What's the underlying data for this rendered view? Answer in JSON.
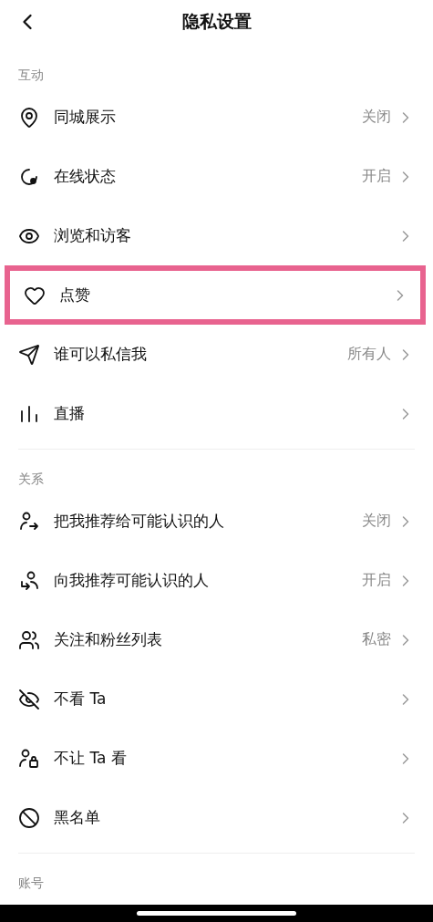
{
  "header": {
    "title": "隐私设置"
  },
  "sections": [
    {
      "label": "互动",
      "items": [
        {
          "label": "同城展示",
          "value": "关闭",
          "highlighted": false
        },
        {
          "label": "在线状态",
          "value": "开启",
          "highlighted": false
        },
        {
          "label": "浏览和访客",
          "highlighted": false
        },
        {
          "label": "点赞",
          "highlighted": true
        },
        {
          "label": "谁可以私信我",
          "value": "所有人",
          "highlighted": false
        },
        {
          "label": "直播",
          "highlighted": false
        }
      ]
    },
    {
      "label": "关系",
      "items": [
        {
          "label": "把我推荐给可能认识的人",
          "value": "关闭",
          "highlighted": false
        },
        {
          "label": "向我推荐可能认识的人",
          "value": "开启",
          "highlighted": false
        },
        {
          "label": "关注和粉丝列表",
          "value": "私密",
          "highlighted": false
        },
        {
          "label": "不看 Ta",
          "highlighted": false
        },
        {
          "label": "不让 Ta 看",
          "highlighted": false
        },
        {
          "label": "黑名单",
          "highlighted": false
        }
      ]
    },
    {
      "label": "账号"
    }
  ]
}
